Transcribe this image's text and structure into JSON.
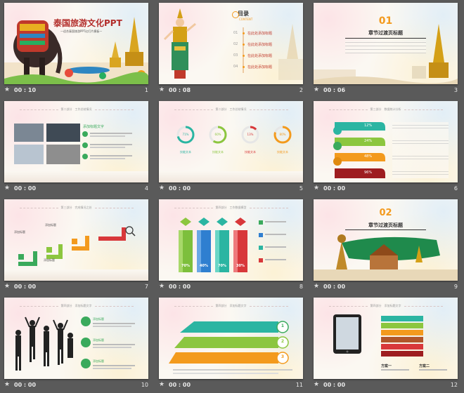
{
  "slides": [
    {
      "number": "1",
      "time": "00 : 10",
      "title": "泰国旅游文化PPT",
      "subtitle": "—适合泰国旅游PPT幻灯片模板—"
    },
    {
      "number": "2",
      "time": "00 : 08",
      "heading": "目录",
      "heading_en": "CONTENT",
      "items": [
        "在此处添加标题",
        "在此处添加标题",
        "在此处添加标题",
        "在此处添加标题"
      ],
      "numbers": [
        "01",
        "02",
        "03",
        "04"
      ]
    },
    {
      "number": "3",
      "time": "00 : 06",
      "big_number": "01",
      "title": "章节过渡页标题"
    },
    {
      "number": "4",
      "time": "00 : 00",
      "header": "第二部分　工作总结情况",
      "label": "添加标题文字"
    },
    {
      "number": "5",
      "time": "00 : 00",
      "header": "第二部分　工作总结情况",
      "percents": [
        "71%",
        "60%",
        "13%",
        "80%"
      ],
      "labels": [
        "技能文本",
        "技能文本",
        "技能文本",
        "技能文本"
      ]
    },
    {
      "number": "6",
      "time": "00 : 00",
      "header": "第三部分　数据统计分析",
      "percents": [
        "12%",
        "24%",
        "48%",
        "96%"
      ]
    },
    {
      "number": "7",
      "time": "00 : 00",
      "header": "第三部分　完成情况之处",
      "labels": [
        "添加标题",
        "添加标题",
        "添加标题"
      ]
    },
    {
      "number": "8",
      "time": "00 : 00",
      "header": "第四部分　工作数据模型",
      "percents": [
        "70%",
        "40%",
        "70%",
        "30%"
      ]
    },
    {
      "number": "9",
      "time": "00 : 00",
      "big_number": "02",
      "title": "章节过渡页标题"
    },
    {
      "number": "10",
      "time": "00 : 00",
      "header": "第四部分　添加标题文字",
      "labels": [
        "添加标题",
        "添加标题",
        "添加标题"
      ]
    },
    {
      "number": "11",
      "time": "00 : 00",
      "header": "第四部分　添加标题文字",
      "steps": [
        "1",
        "2",
        "3"
      ]
    },
    {
      "number": "12",
      "time": "00 : 00",
      "header": "第四部分　添加标题文字",
      "plans": [
        "方案一",
        "方案二"
      ]
    }
  ],
  "colors": {
    "green": "#3aaa5c",
    "teal": "#2bb5a2",
    "orange": "#f39a1d",
    "red": "#d8383a",
    "blue": "#2f7fd0",
    "darkred": "#9e1d20",
    "gold": "#d4a017"
  }
}
